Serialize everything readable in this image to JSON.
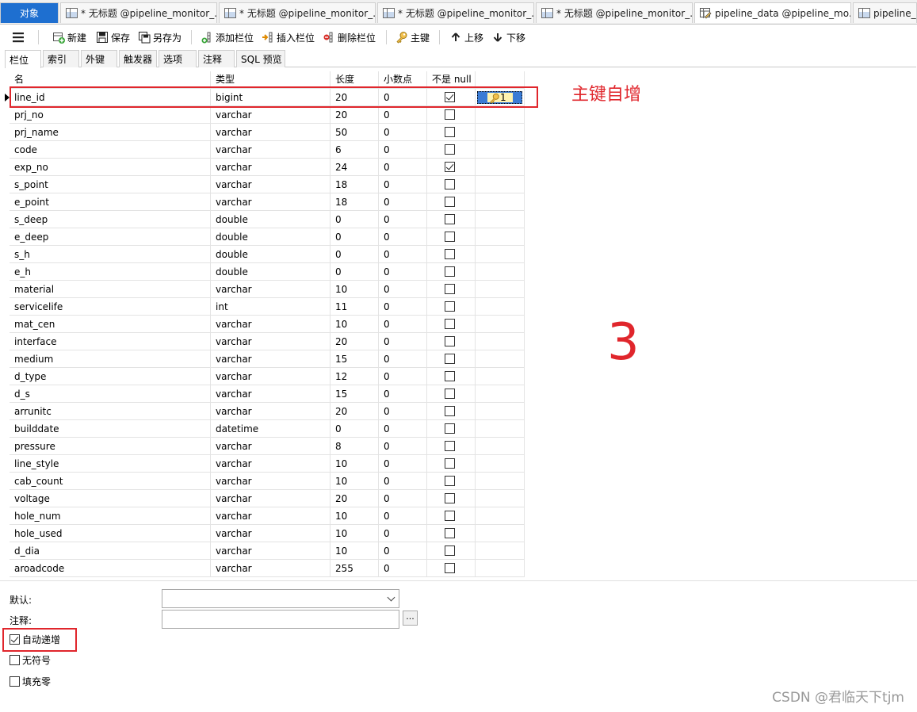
{
  "tabs": [
    {
      "label": "对象",
      "kind": "objects"
    },
    {
      "label": "* 无标题 @pipeline_monitor_...",
      "kind": "table"
    },
    {
      "label": "* 无标题 @pipeline_monitor_...",
      "kind": "table"
    },
    {
      "label": "* 无标题 @pipeline_monitor_...",
      "kind": "table"
    },
    {
      "label": "* 无标题 @pipeline_monitor_...",
      "kind": "table"
    },
    {
      "label": "pipeline_data @pipeline_mo...",
      "kind": "design"
    },
    {
      "label": "pipeline_d",
      "kind": "table"
    }
  ],
  "toolbar": {
    "new": "新建",
    "save": "保存",
    "save_as": "另存为",
    "add_field": "添加栏位",
    "insert_field": "插入栏位",
    "delete_field": "删除栏位",
    "primary_key": "主键",
    "move_up": "上移",
    "move_down": "下移"
  },
  "subtabs": [
    "栏位",
    "索引",
    "外键",
    "触发器",
    "选项",
    "注释",
    "SQL 预览"
  ],
  "grid": {
    "headers": [
      "名",
      "类型",
      "长度",
      "小数点",
      "不是 null",
      ""
    ],
    "rows": [
      {
        "name": "line_id",
        "type": "bigint",
        "length": "20",
        "decimals": "0",
        "not_null": true,
        "key": "1"
      },
      {
        "name": "prj_no",
        "type": "varchar",
        "length": "20",
        "decimals": "0",
        "not_null": false
      },
      {
        "name": "prj_name",
        "type": "varchar",
        "length": "50",
        "decimals": "0",
        "not_null": false
      },
      {
        "name": "code",
        "type": "varchar",
        "length": "6",
        "decimals": "0",
        "not_null": false
      },
      {
        "name": "exp_no",
        "type": "varchar",
        "length": "24",
        "decimals": "0",
        "not_null": true
      },
      {
        "name": "s_point",
        "type": "varchar",
        "length": "18",
        "decimals": "0",
        "not_null": false
      },
      {
        "name": "e_point",
        "type": "varchar",
        "length": "18",
        "decimals": "0",
        "not_null": false
      },
      {
        "name": "s_deep",
        "type": "double",
        "length": "0",
        "decimals": "0",
        "not_null": false
      },
      {
        "name": "e_deep",
        "type": "double",
        "length": "0",
        "decimals": "0",
        "not_null": false
      },
      {
        "name": "s_h",
        "type": "double",
        "length": "0",
        "decimals": "0",
        "not_null": false
      },
      {
        "name": "e_h",
        "type": "double",
        "length": "0",
        "decimals": "0",
        "not_null": false
      },
      {
        "name": "material",
        "type": "varchar",
        "length": "10",
        "decimals": "0",
        "not_null": false
      },
      {
        "name": "servicelife",
        "type": "int",
        "length": "11",
        "decimals": "0",
        "not_null": false
      },
      {
        "name": "mat_cen",
        "type": "varchar",
        "length": "10",
        "decimals": "0",
        "not_null": false
      },
      {
        "name": "interface",
        "type": "varchar",
        "length": "20",
        "decimals": "0",
        "not_null": false
      },
      {
        "name": "medium",
        "type": "varchar",
        "length": "15",
        "decimals": "0",
        "not_null": false
      },
      {
        "name": "d_type",
        "type": "varchar",
        "length": "12",
        "decimals": "0",
        "not_null": false
      },
      {
        "name": "d_s",
        "type": "varchar",
        "length": "15",
        "decimals": "0",
        "not_null": false
      },
      {
        "name": "arrunitc",
        "type": "varchar",
        "length": "20",
        "decimals": "0",
        "not_null": false
      },
      {
        "name": "builddate",
        "type": "datetime",
        "length": "0",
        "decimals": "0",
        "not_null": false
      },
      {
        "name": "pressure",
        "type": "varchar",
        "length": "8",
        "decimals": "0",
        "not_null": false
      },
      {
        "name": "line_style",
        "type": "varchar",
        "length": "10",
        "decimals": "0",
        "not_null": false
      },
      {
        "name": "cab_count",
        "type": "varchar",
        "length": "10",
        "decimals": "0",
        "not_null": false
      },
      {
        "name": "voltage",
        "type": "varchar",
        "length": "20",
        "decimals": "0",
        "not_null": false
      },
      {
        "name": "hole_num",
        "type": "varchar",
        "length": "10",
        "decimals": "0",
        "not_null": false
      },
      {
        "name": "hole_used",
        "type": "varchar",
        "length": "10",
        "decimals": "0",
        "not_null": false
      },
      {
        "name": "d_dia",
        "type": "varchar",
        "length": "10",
        "decimals": "0",
        "not_null": false
      },
      {
        "name": "aroadcode",
        "type": "varchar",
        "length": "255",
        "decimals": "0",
        "not_null": false
      }
    ]
  },
  "annotations": {
    "primary_key_note": "主键自增",
    "step_number": "3"
  },
  "bottom": {
    "default_label": "默认:",
    "default_value": "",
    "comment_label": "注释:",
    "comment_value": "",
    "comment_button": "...",
    "auto_increment": {
      "label": "自动递增",
      "checked": true
    },
    "unsigned": {
      "label": "无符号",
      "checked": false
    },
    "zerofill": {
      "label": "填充零",
      "checked": false
    }
  },
  "watermark": "CSDN @君临天下tjm",
  "colors": {
    "accent": "#1e6fd0",
    "annotation": "#e0262c",
    "key_highlight": "#3a7bd5"
  }
}
